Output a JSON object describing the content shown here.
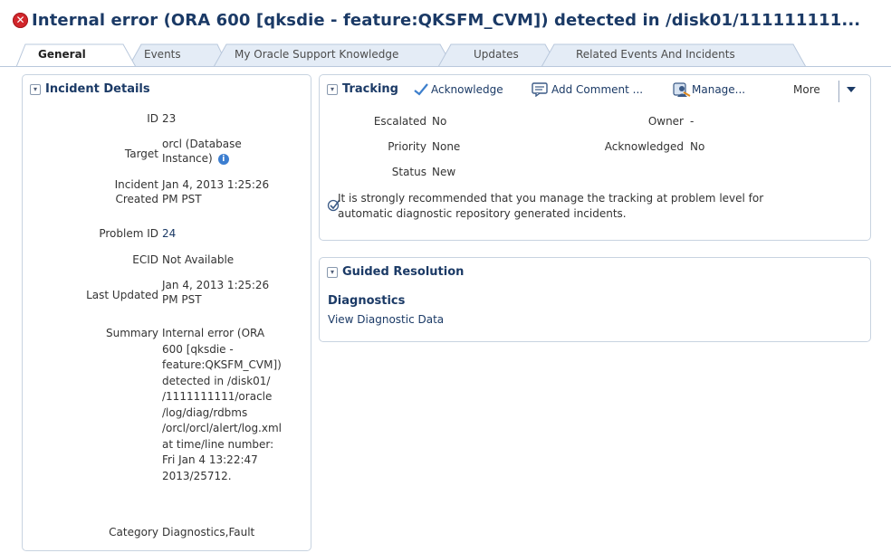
{
  "page": {
    "title": "Internal error (ORA 600 [qksdie - feature:QKSFM_CVM]) detected in /disk01/111111111...",
    "error_icon": "error-icon"
  },
  "tabs": [
    {
      "label": "General",
      "active": true
    },
    {
      "label": "Events",
      "active": false
    },
    {
      "label": "My Oracle Support Knowledge",
      "active": false
    },
    {
      "label": "Updates",
      "active": false
    },
    {
      "label": "Related Events And Incidents",
      "active": false
    }
  ],
  "incident_details": {
    "title": "Incident Details",
    "id_label": "ID",
    "id_value": "23",
    "target_label": "Target",
    "target_value_line1": "orcl  (Database",
    "target_value_line2": "Instance)",
    "incident_created_label_line1": "Incident",
    "incident_created_label_line2": "Created",
    "incident_created_value_line1": "Jan 4, 2013 1:25:26",
    "incident_created_value_line2": "PM PST",
    "problem_id_label": "Problem ID",
    "problem_id_value": "24",
    "ecid_label": "ECID",
    "ecid_value": "Not Available",
    "last_updated_label": "Last Updated",
    "last_updated_value_line1": "Jan 4, 2013 1:25:26",
    "last_updated_value_line2": "PM PST",
    "summary_label": "Summary",
    "summary_lines": [
      "Internal error (ORA",
      "600 [qksdie -",
      "feature:QKSFM_CVM])",
      "detected in /disk01/",
      "/1111111111/oracle",
      "/log/diag/rdbms",
      "/orcl/orcl/alert/log.xml",
      "at time/line number:",
      "Fri Jan 4 13:22:47",
      "2013/25712."
    ],
    "category_label": "Category",
    "category_value": "Diagnostics,Fault"
  },
  "tracking": {
    "title": "Tracking",
    "acknowledge_label": "Acknowledge",
    "add_comment_label": "Add Comment ...",
    "manage_label": "Manage...",
    "more_label": "More",
    "escalated_label": "Escalated",
    "escalated_value": "No",
    "priority_label": "Priority",
    "priority_value": "None",
    "status_label": "Status",
    "status_value": "New",
    "owner_label": "Owner",
    "owner_value": "-",
    "acknowledged_label": "Acknowledged",
    "acknowledged_value": "No",
    "note_line1": "It is strongly recommended that you manage the tracking at problem level for",
    "note_line2": "automatic diagnostic repository generated incidents."
  },
  "guided_resolution": {
    "title": "Guided Resolution",
    "diagnostics_heading": "Diagnostics",
    "view_diag_link": "View Diagnostic Data"
  },
  "colors": {
    "title_blue": "#1b3a66",
    "error_red": "#d2262b",
    "panel_border": "#c8d3e0",
    "tab_fill": "#e4ecf6"
  }
}
